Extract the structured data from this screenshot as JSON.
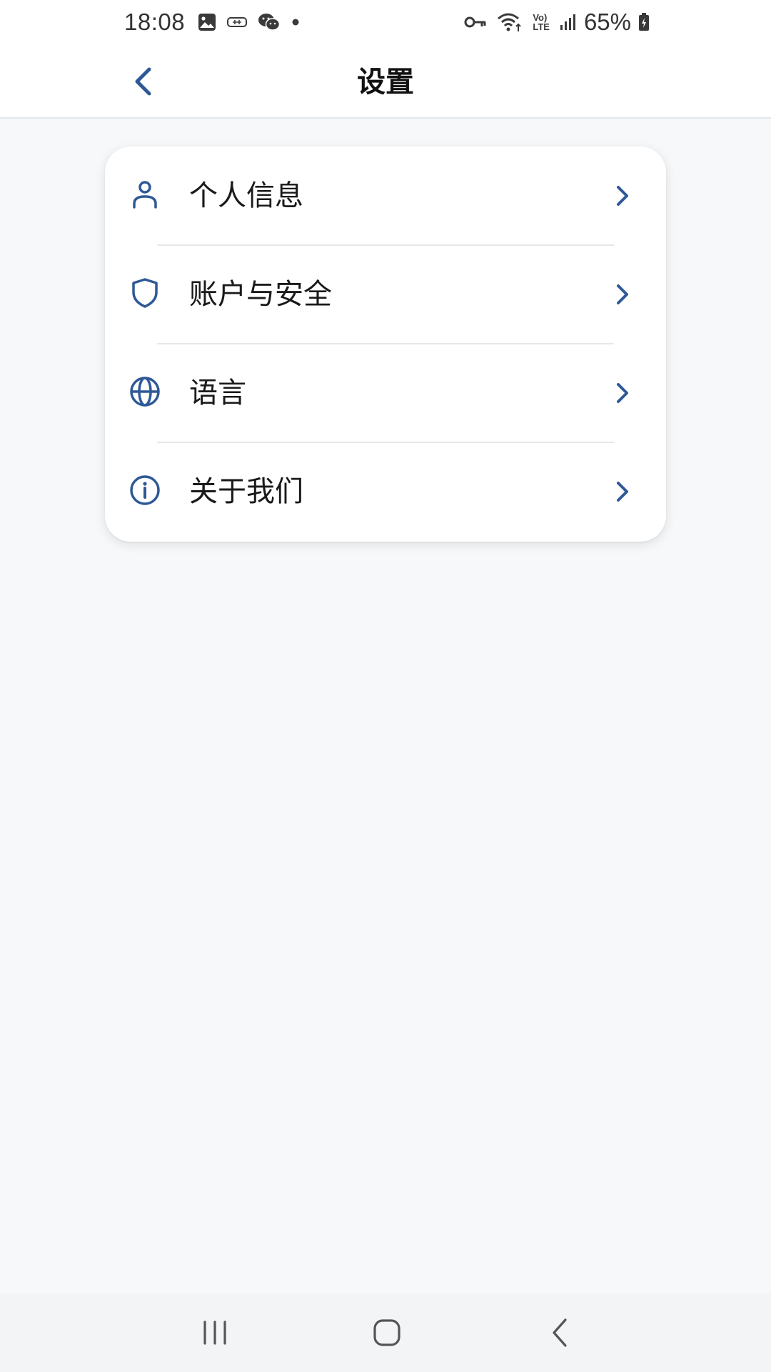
{
  "status_bar": {
    "time": "18:08",
    "left_icons": [
      "gallery-icon",
      "tag-icon",
      "wechat-icon",
      "dot-icon"
    ],
    "right_icons": [
      "key-icon",
      "wifi-icon",
      "volte-icon",
      "signal-icon",
      "battery-icon"
    ],
    "volte_top": "Vo)",
    "volte_bottom": "LTE",
    "battery": "65%"
  },
  "header": {
    "title": "设置",
    "back_icon": "chevron-left-icon"
  },
  "menu": {
    "items": [
      {
        "label": "个人信息",
        "icon": "person-icon"
      },
      {
        "label": "账户与安全",
        "icon": "shield-icon"
      },
      {
        "label": "语言",
        "icon": "globe-icon"
      },
      {
        "label": "关于我们",
        "icon": "info-icon"
      }
    ]
  },
  "nav_bar": {
    "buttons": [
      "recent-apps-icon",
      "home-icon",
      "back-icon"
    ]
  },
  "colors": {
    "accent": "#2e5897",
    "page_bg": "#f6f8fa",
    "card_bg": "#ffffff",
    "divider": "#e8e8e8"
  }
}
